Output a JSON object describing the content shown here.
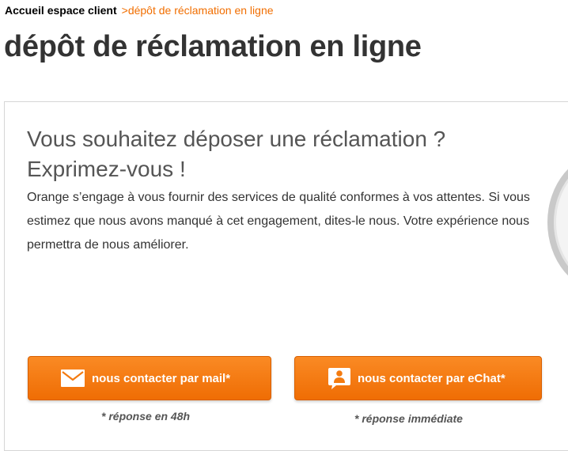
{
  "breadcrumb": {
    "home": "Accueil espace client",
    "separator": ">",
    "current": "dépôt de réclamation en ligne"
  },
  "page_title": "dépôt de réclamation en ligne",
  "card": {
    "heading_line1": "Vous souhaitez déposer une réclamation ?",
    "heading_line2": "Exprimez-vous !",
    "body": "Orange s’engage à vous fournir des services de qualité conformes à vos attentes. Si vous estimez que nous avons manqué à cet engagement, dites-le nous. Votre expérience nous permettra de nous améliorer."
  },
  "buttons": {
    "mail": {
      "label": "nous contacter par mail*",
      "icon": "envelope-icon",
      "note": "* réponse en 48h"
    },
    "chat": {
      "label": "nous contacter par eChat*",
      "icon": "chat-person-icon",
      "note": "* réponse immédiate"
    }
  },
  "colors": {
    "accent": "#f16e00",
    "button": "#f47b10",
    "title": "#333333"
  }
}
